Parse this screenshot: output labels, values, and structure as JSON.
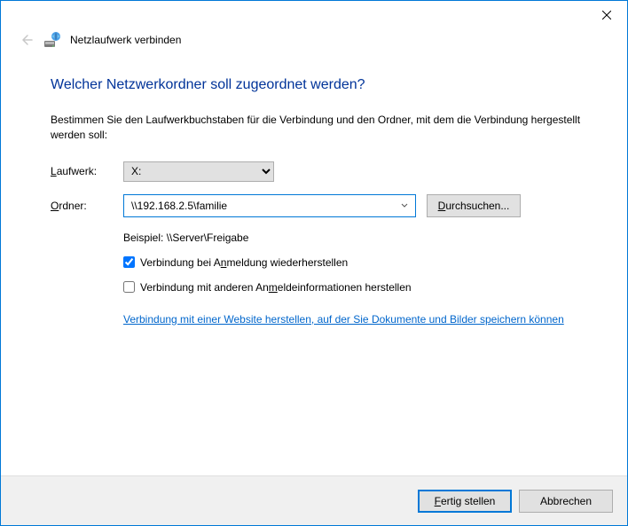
{
  "wizard_title": "Netzlaufwerk verbinden",
  "heading": "Welcher Netzwerkordner soll zugeordnet werden?",
  "instruction": "Bestimmen Sie den Laufwerkbuchstaben für die Verbindung und den Ordner, mit dem die Verbindung hergestellt werden soll:",
  "drive": {
    "label_pre": "L",
    "label_post": "aufwerk:",
    "value": "X:"
  },
  "folder": {
    "label_pre": "O",
    "label_post": "rdner:",
    "value": "\\\\192.168.2.5\\familie"
  },
  "browse": {
    "pre": "D",
    "post": "urchsuchen..."
  },
  "example": "Beispiel: \\\\Server\\Freigabe",
  "cb_reconnect": {
    "checked": true,
    "pre": "Verbindung bei A",
    "u": "n",
    "post": "meldung wiederherstellen"
  },
  "cb_credentials": {
    "checked": false,
    "pre": "Verbindung mit anderen An",
    "u": "m",
    "post": "eldeinformationen herstellen"
  },
  "link_text": "Verbindung mit einer Website herstellen, auf der Sie Dokumente und Bilder speichern können",
  "finish": {
    "pre": "F",
    "post": "ertig stellen"
  },
  "cancel": "Abbrechen"
}
